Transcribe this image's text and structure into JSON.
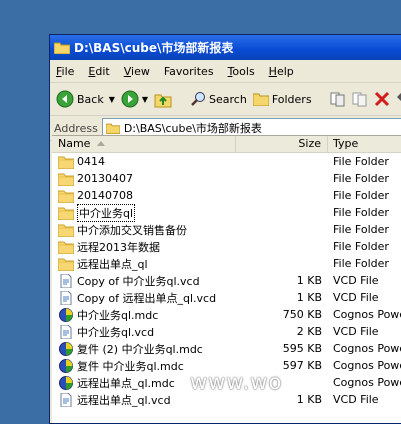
{
  "window": {
    "title": "D:\\BAS\\cube\\市场部新报表"
  },
  "menu": [
    {
      "mnemonic": "F",
      "rest": "ile"
    },
    {
      "mnemonic": "E",
      "rest": "dit"
    },
    {
      "mnemonic": "V",
      "rest": "iew"
    },
    {
      "mnemonic": "",
      "rest": "Favorites"
    },
    {
      "mnemonic": "T",
      "rest": "ools"
    },
    {
      "mnemonic": "H",
      "rest": "elp"
    }
  ],
  "toolbar": {
    "back_label": "Back",
    "search_label": "Search",
    "folders_label": "Folders"
  },
  "address": {
    "label": "Address",
    "value": "D:\\BAS\\cube\\市场部新报表"
  },
  "columns": {
    "name": "Name",
    "size": "Size",
    "type": "Type"
  },
  "files": [
    {
      "icon": "folder-icon",
      "name": "0414",
      "size": "",
      "type": "File Folder"
    },
    {
      "icon": "folder-icon",
      "name": "20130407",
      "size": "",
      "type": "File Folder"
    },
    {
      "icon": "folder-icon",
      "name": "20140708",
      "size": "",
      "type": "File Folder"
    },
    {
      "icon": "folder-icon",
      "name": "中介业务ql",
      "size": "",
      "type": "File Folder",
      "selected": true
    },
    {
      "icon": "folder-icon",
      "name": "中介添加交叉销售备份",
      "size": "",
      "type": "File Folder"
    },
    {
      "icon": "folder-icon",
      "name": "远程2013年数据",
      "size": "",
      "type": "File Folder"
    },
    {
      "icon": "folder-icon",
      "name": "远程出单点_ql",
      "size": "",
      "type": "File Folder"
    },
    {
      "icon": "vcd-file-icon",
      "name": "Copy of 中介业务ql.vcd",
      "size": "1 KB",
      "type": "VCD File"
    },
    {
      "icon": "vcd-file-icon",
      "name": "Copy of 远程出单点_ql.vcd",
      "size": "1 KB",
      "type": "VCD File"
    },
    {
      "icon": "cognos-icon",
      "name": "中介业务ql.mdc",
      "size": "750 KB",
      "type": "Cognos Powe"
    },
    {
      "icon": "vcd-file-icon",
      "name": "中介业务ql.vcd",
      "size": "2 KB",
      "type": "VCD File"
    },
    {
      "icon": "cognos-icon",
      "name": "复件 (2) 中介业务ql.mdc",
      "size": "595 KB",
      "type": "Cognos Powe"
    },
    {
      "icon": "cognos-icon",
      "name": "复件 中介业务ql.mdc",
      "size": "597 KB",
      "type": "Cognos Powe"
    },
    {
      "icon": "cognos-icon",
      "name": "远程出单点_ql.mdc",
      "size": "",
      "type": "Cognos Powe"
    },
    {
      "icon": "vcd-file-icon",
      "name": "远程出单点_ql.vcd",
      "size": "1 KB",
      "type": "VCD File"
    }
  ],
  "watermark": "www.wo"
}
